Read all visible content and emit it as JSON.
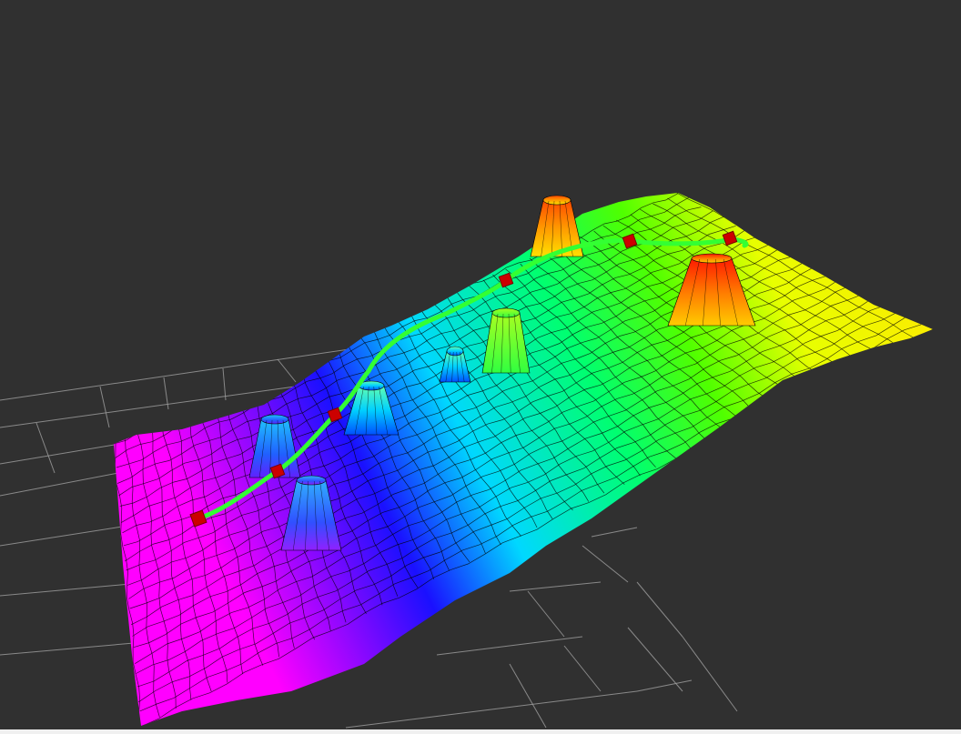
{
  "viewport": {
    "background_color": "#303030",
    "grid_color": "#a0a0a0",
    "mesh_line_color": "#000000"
  },
  "terrain": {
    "colormap": [
      "#ff00ff",
      "#0000ff",
      "#00ffff",
      "#00ff00",
      "#ffff00",
      "#ff0000"
    ],
    "peak_count": 7
  },
  "path": {
    "line_color": "#33ff33",
    "waypoint_color": "#cc0000",
    "waypoint_count": 6
  }
}
